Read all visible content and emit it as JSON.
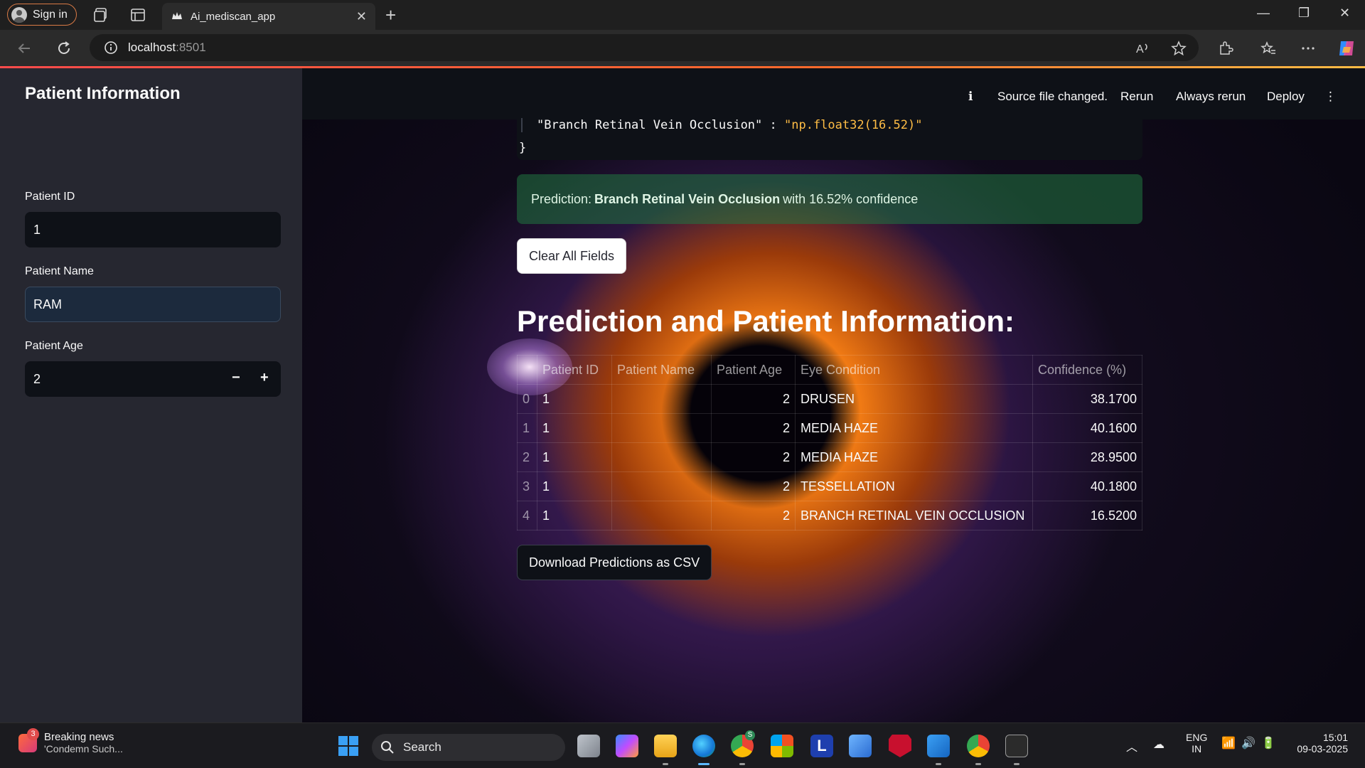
{
  "browser": {
    "signin_label": "Sign in",
    "tab_title": "Ai_mediscan_app",
    "url_host": "localhost",
    "url_port": ":8501"
  },
  "sidebar": {
    "title": "Patient Information",
    "patient_id_label": "Patient ID",
    "patient_id_value": "1",
    "patient_name_label": "Patient Name",
    "patient_name_value": "RAM",
    "patient_age_label": "Patient Age",
    "patient_age_value": "2",
    "minus": "−",
    "plus": "+"
  },
  "header": {
    "info_icon": "ℹ",
    "status": "Source file changed.",
    "rerun": "Rerun",
    "always_rerun": "Always rerun",
    "deploy": "Deploy",
    "menu": "⋮"
  },
  "code": {
    "key": "\"Branch Retinal Vein Occlusion\"",
    "sep": " : ",
    "value": "\"np.float32(16.52)\"",
    "close": "}"
  },
  "alert": {
    "prefix": "Prediction:",
    "condition": "Branch Retinal Vein Occlusion",
    "suffix": "with 16.52% confidence"
  },
  "buttons": {
    "clear": "Clear All Fields",
    "download": "Download Predictions as CSV"
  },
  "main": {
    "heading": "Prediction and Patient Information:"
  },
  "table": {
    "columns": [
      "",
      "Patient ID",
      "Patient Name",
      "Patient Age",
      "Eye Condition",
      "Confidence (%)"
    ],
    "rows": [
      [
        "0",
        "1",
        "",
        "2",
        "DRUSEN",
        "38.1700"
      ],
      [
        "1",
        "1",
        "",
        "2",
        "MEDIA HAZE",
        "40.1600"
      ],
      [
        "2",
        "1",
        "",
        "2",
        "MEDIA HAZE",
        "28.9500"
      ],
      [
        "3",
        "1",
        "",
        "2",
        "TESSELLATION",
        "40.1800"
      ],
      [
        "4",
        "1",
        "",
        "2",
        "BRANCH RETINAL VEIN OCCLUSION",
        "16.5200"
      ]
    ]
  },
  "taskbar": {
    "news_title": "Breaking news",
    "news_sub": "'Condemn Such...",
    "news_badge": "3",
    "search_label": "Search",
    "lang": "ENG",
    "region": "IN",
    "time": "15:01",
    "date": "09-03-2025",
    "chrome_badge": "S",
    "l_app": "L"
  },
  "colors": {
    "accent": "#ff4b4b",
    "success_bg": "#217640",
    "sidebar_bg": "#262730",
    "app_bg": "#0e1117"
  }
}
